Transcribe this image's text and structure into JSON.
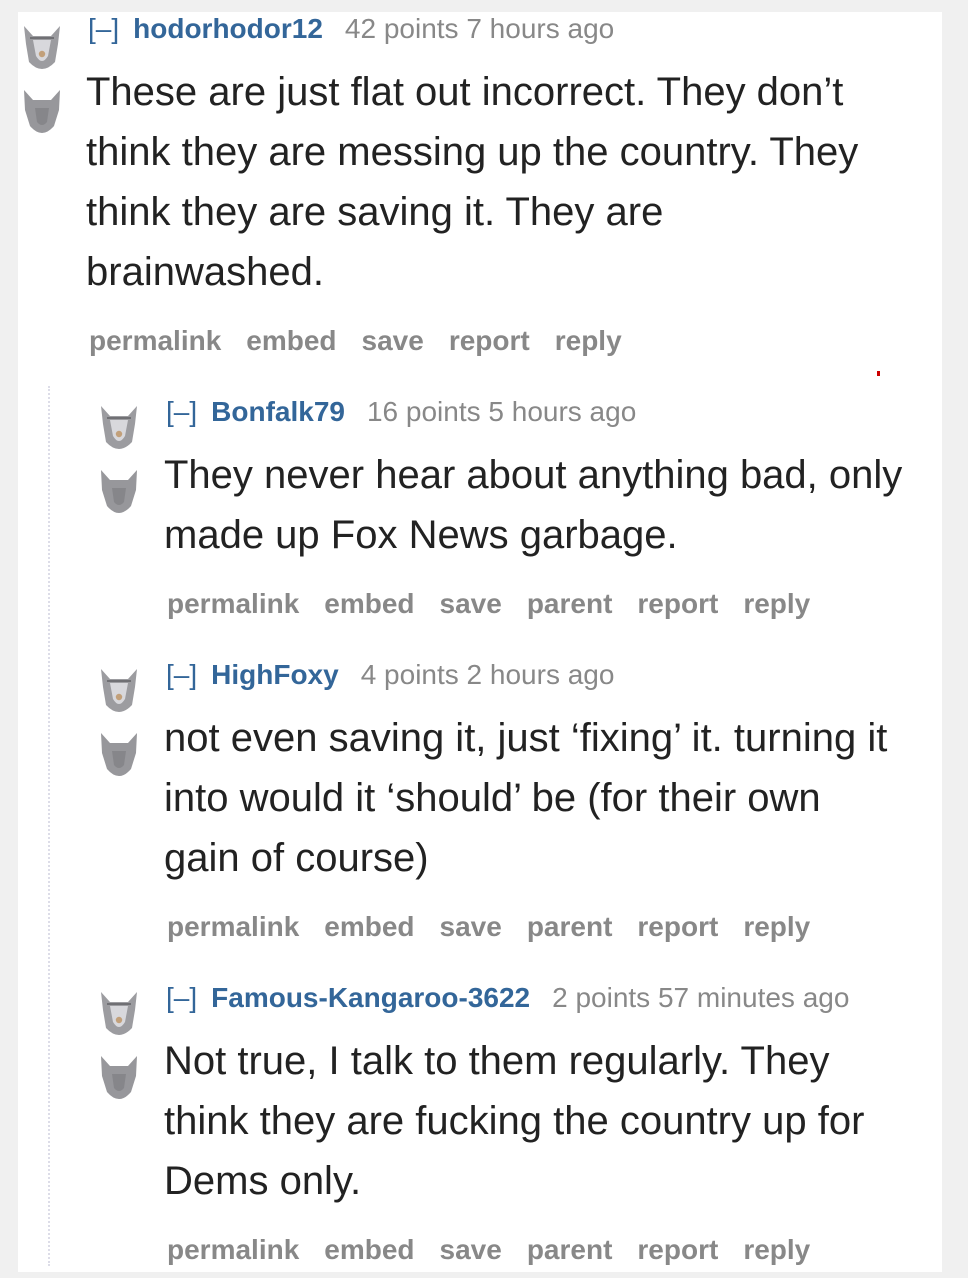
{
  "comments": [
    {
      "collapse": "[–]",
      "author": "hodorhodor12",
      "meta": "42 points 7 hours ago",
      "lines": [
        "These are just flat out incorrect. They don’t",
        "think they are messing up the country. They",
        "think they are saving it. They are",
        "brainwashed."
      ],
      "actions": [
        "permalink",
        "embed",
        "save",
        "report",
        "reply"
      ]
    },
    {
      "collapse": "[–]",
      "author": "Bonfalk79",
      "meta": "16 points 5 hours ago",
      "lines": [
        "They never hear about anything bad, only",
        "made up Fox News garbage."
      ],
      "actions": [
        "permalink",
        "embed",
        "save",
        "parent",
        "report",
        "reply"
      ]
    },
    {
      "collapse": "[–]",
      "author": "HighFoxy",
      "meta": "4 points 2 hours ago",
      "lines": [
        "not even saving it, just ‘fixing’ it. turning it",
        "into would it ‘should’ be (for their own",
        "gain of course)"
      ],
      "actions": [
        "permalink",
        "embed",
        "save",
        "parent",
        "report",
        "reply"
      ]
    },
    {
      "collapse": "[–]",
      "author": "Famous-Kangaroo-3622",
      "meta": "2 points 57 minutes ago",
      "lines": [
        "Not true, I talk to them regularly. They",
        "think they are fucking the country up for",
        "Dems only."
      ],
      "actions": [
        "permalink",
        "embed",
        "save",
        "parent",
        "report",
        "reply"
      ]
    }
  ],
  "icons": {
    "upvote": "wolf-upvote-icon",
    "downvote": "wolf-downvote-icon"
  },
  "colors": {
    "author": "#336699",
    "meta": "#888888",
    "body": "#222222"
  }
}
